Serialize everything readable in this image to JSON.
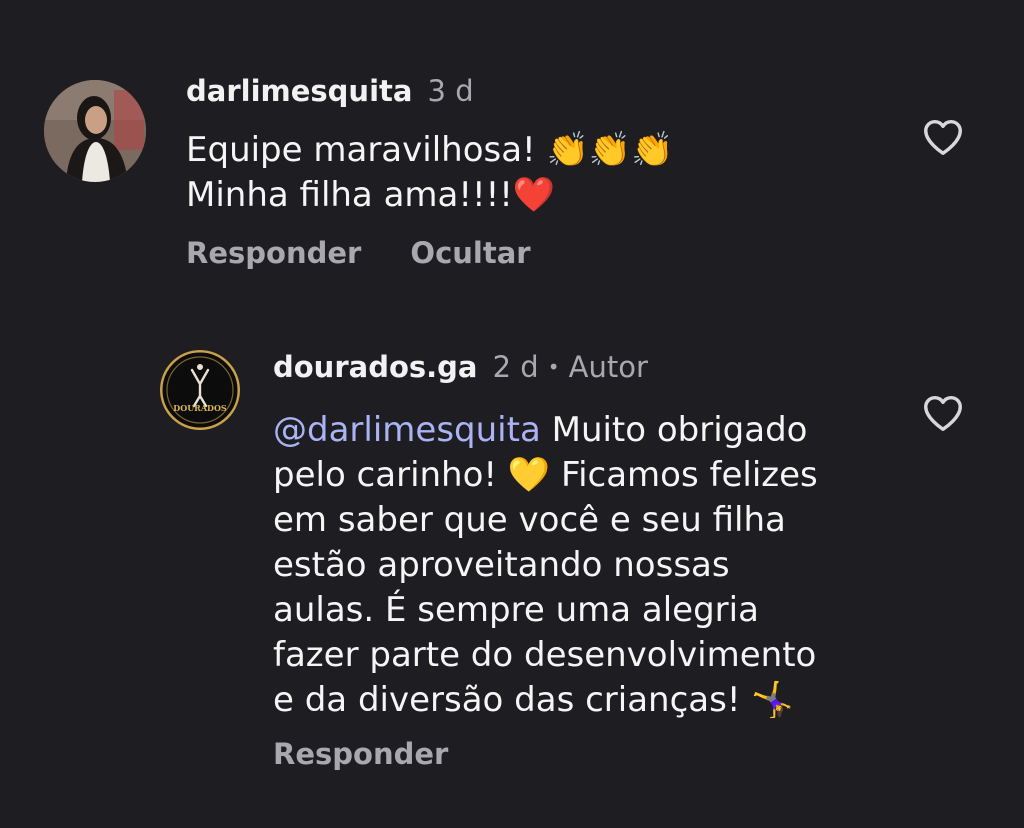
{
  "comments": [
    {
      "username": "darlimesquita",
      "time": "3 d",
      "line1": "Equipe maravilhosa! 👏👏👏",
      "line2": "Minha filha ama!!!!❤️",
      "reply_label": "Responder",
      "hide_label": "Ocultar"
    },
    {
      "username": "dourados.ga",
      "time": "2 d",
      "separator": "•",
      "author_label": "Autor",
      "avatar_text": "DOURADOS",
      "mention": "@darlimesquita",
      "lines": [
        " Muito obrigado",
        "pelo carinho! 💛 Ficamos felizes",
        "em saber que você e seu filha",
        "estão aproveitando nossas",
        "aulas. É sempre uma alegria",
        "fazer parte do desenvolvimento",
        "e da diversão das crianças! 🤸‍♀️"
      ],
      "reply_label": "Responder"
    }
  ],
  "colors": {
    "background": "#1e1e22",
    "text": "#f2f2f2",
    "muted": "#a8a8ae",
    "mention": "#aab4f5",
    "gold": "#c9a24a"
  }
}
